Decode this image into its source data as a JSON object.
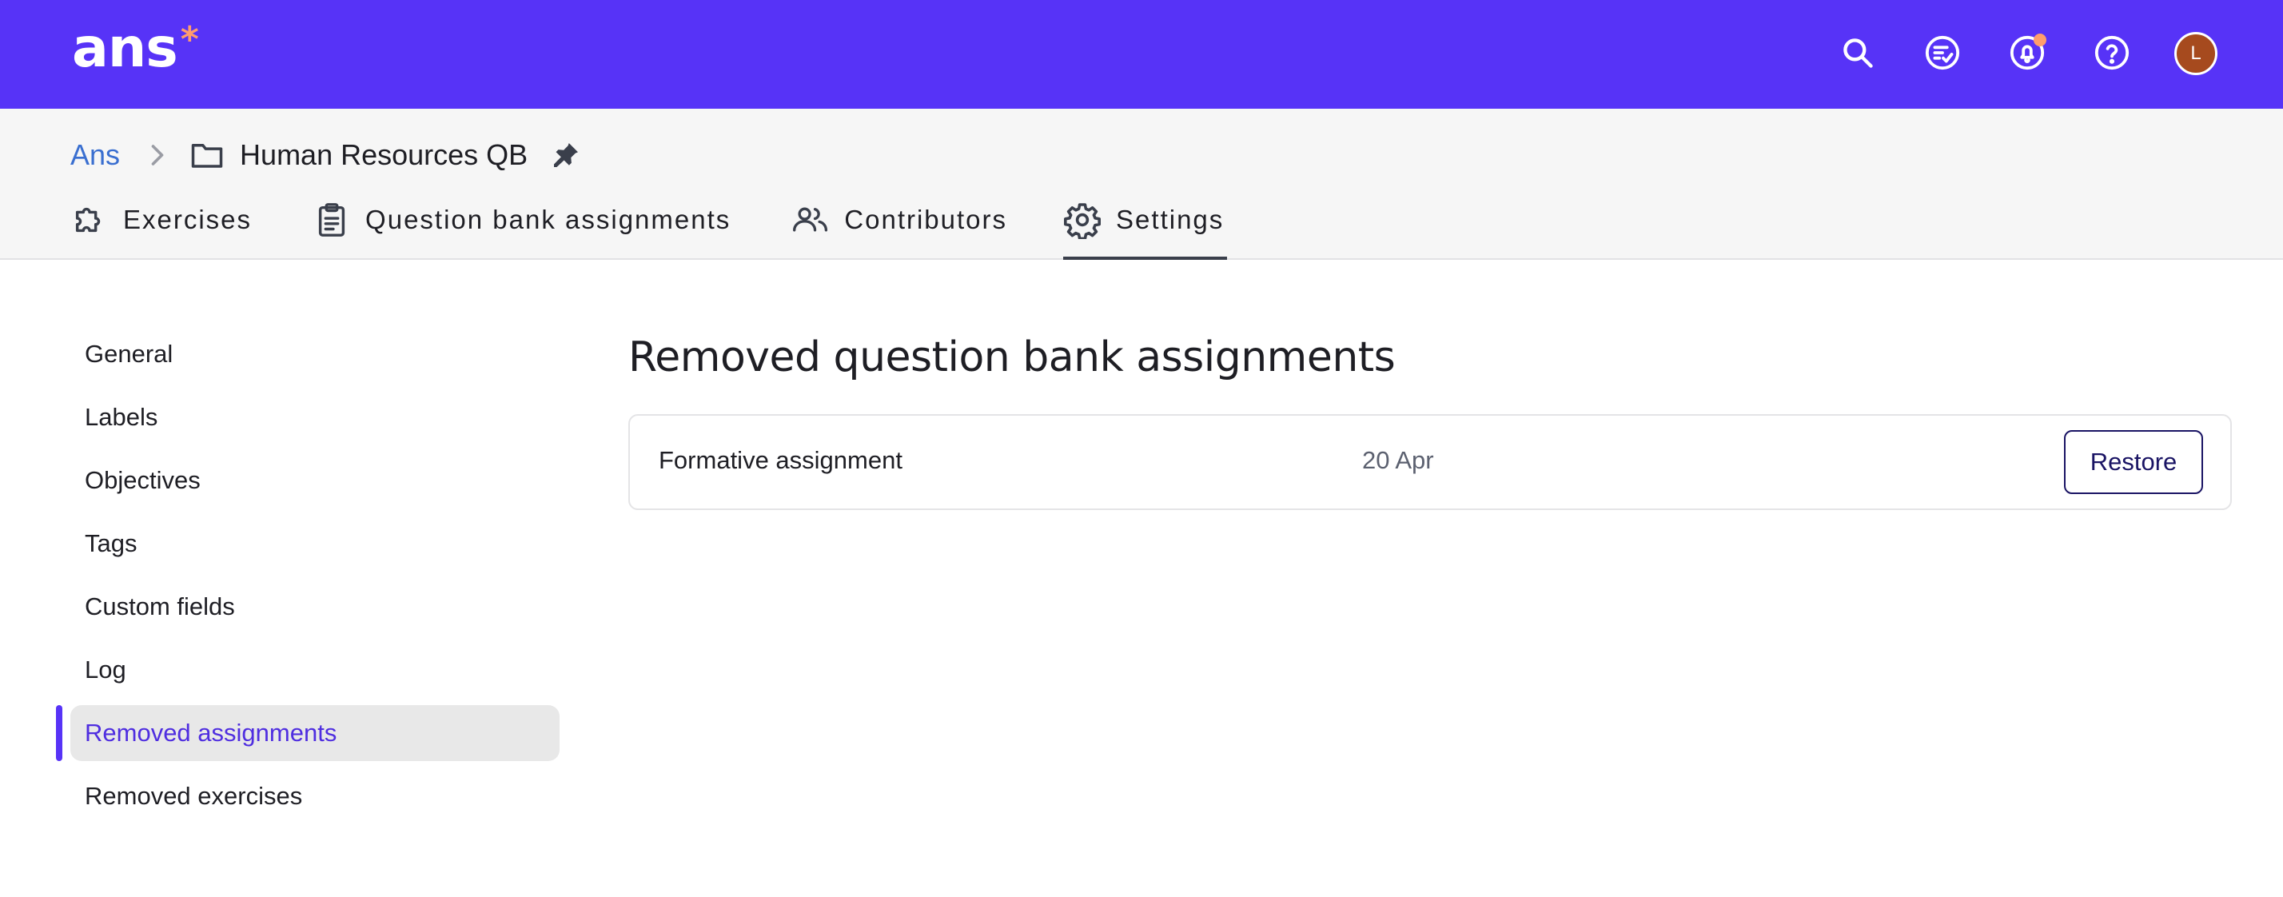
{
  "topbar": {
    "logo_text": "ans",
    "logo_star": "*",
    "brand_color": "#5733f7",
    "accent_color": "#ff9d6c",
    "icons": [
      "search-icon",
      "review-list-icon",
      "notification-bell-icon",
      "help-icon"
    ],
    "avatar_initial": "L"
  },
  "breadcrumb": {
    "root": "Ans",
    "current": "Human Resources QB"
  },
  "tabs": [
    {
      "label": "Exercises",
      "icon": "puzzle-icon",
      "active": false
    },
    {
      "label": "Question bank assignments",
      "icon": "clipboard-icon",
      "active": false
    },
    {
      "label": "Contributors",
      "icon": "users-icon",
      "active": false
    },
    {
      "label": "Settings",
      "icon": "gear-icon",
      "active": true
    }
  ],
  "sidebar": {
    "items": [
      {
        "label": "General"
      },
      {
        "label": "Labels"
      },
      {
        "label": "Objectives"
      },
      {
        "label": "Tags"
      },
      {
        "label": "Custom fields"
      },
      {
        "label": "Log"
      },
      {
        "label": "Removed assignments",
        "active": true
      },
      {
        "label": "Removed exercises"
      }
    ]
  },
  "main": {
    "title": "Removed question bank assignments",
    "rows": [
      {
        "name": "Formative assignment",
        "date": "20 Apr",
        "action": "Restore"
      }
    ]
  }
}
